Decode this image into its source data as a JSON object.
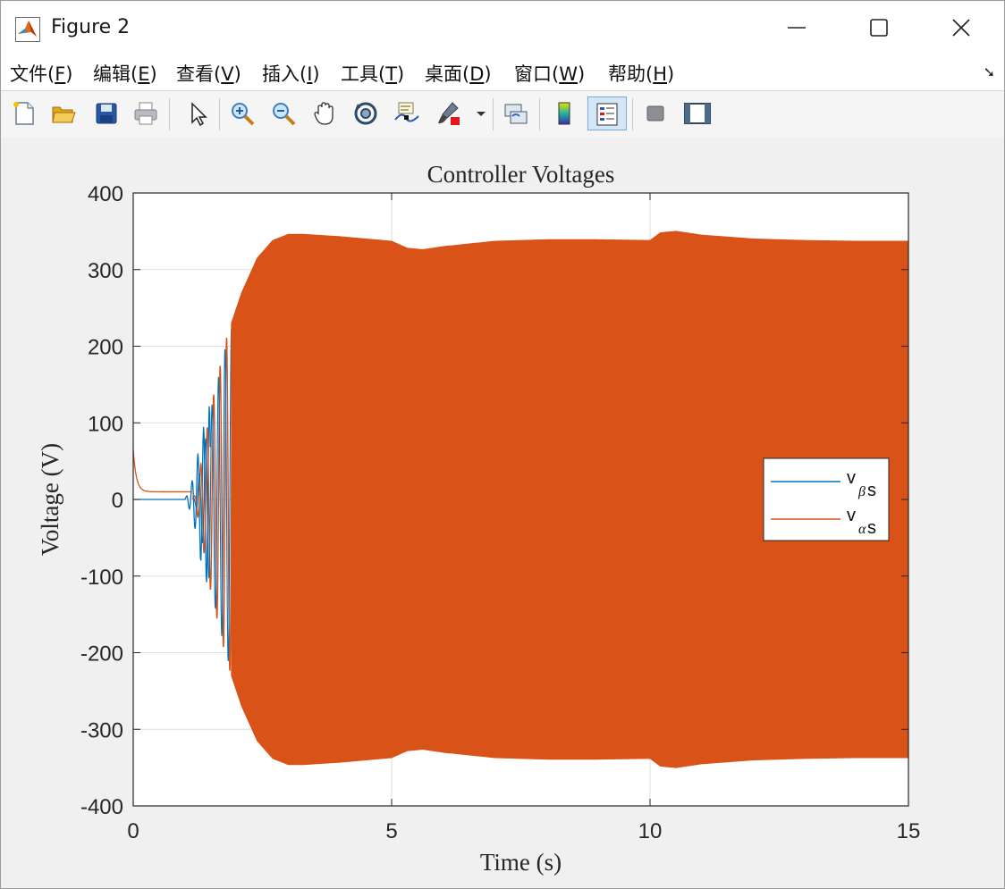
{
  "window": {
    "title": "Figure 2"
  },
  "menu": [
    {
      "label": "文件(",
      "key": "F",
      "tail": ")"
    },
    {
      "label": "编辑(",
      "key": "E",
      "tail": ")"
    },
    {
      "label": "查看(",
      "key": "V",
      "tail": ")"
    },
    {
      "label": "插入(",
      "key": "I",
      "tail": ")"
    },
    {
      "label": "工具(",
      "key": "T",
      "tail": ")"
    },
    {
      "label": "桌面(",
      "key": "D",
      "tail": ")"
    },
    {
      "label": "窗口(",
      "key": "W",
      "tail": ")"
    },
    {
      "label": "帮助(",
      "key": "H",
      "tail": ")"
    }
  ],
  "toolbar": {
    "buttons": [
      "new-figure-icon",
      "open-file-icon",
      "save-icon",
      "print-icon",
      "edit-plot-pointer-icon",
      "zoom-in-icon",
      "zoom-out-icon",
      "pan-hand-icon",
      "rotate-3d-icon",
      "data-cursor-icon",
      "brush-icon",
      "link-plot-icon",
      "colorbar-icon",
      "legend-icon",
      "hide-plot-tools-icon",
      "show-plot-tools-icon"
    ],
    "active": "legend-icon"
  },
  "chart_data": {
    "type": "line",
    "title": "Controller Voltages",
    "xlabel": "Time (s)",
    "ylabel": "Voltage (V)",
    "xlim": [
      0,
      15
    ],
    "ylim": [
      -400,
      400
    ],
    "xticks": [
      "0",
      "5",
      "10",
      "15"
    ],
    "yticks": [
      "400",
      "300",
      "200",
      "100",
      "0",
      "-100",
      "-200",
      "-300",
      "-400"
    ],
    "grid": true,
    "legend_position": "right",
    "series": [
      {
        "name": "v_beta s",
        "legend_main": "v",
        "legend_sub": "β",
        "legend_tail": " s",
        "color": "#0072BD",
        "description": "flat at 0 V until ~1.1 s, then a growing oscillation hidden behind the alpha band",
        "envelope_t": [
          0,
          1.0,
          1.1,
          1.2,
          1.3,
          1.5
        ],
        "envelope_amp": [
          0,
          0,
          15,
          40,
          80,
          130
        ]
      },
      {
        "name": "v_alpha s",
        "legend_main": "v",
        "legend_sub": "α",
        "legend_tail": " s",
        "color": "#D95319",
        "start_value": 65,
        "settle_value": 10,
        "envelope_t": [
          0,
          1.2,
          1.5,
          1.8,
          2.1,
          2.4,
          2.7,
          3.0,
          3.3,
          4.0,
          4.5,
          5.0,
          5.3,
          5.6,
          6.0,
          7.0,
          8.0,
          9.0,
          10.0,
          10.2,
          10.5,
          11.0,
          12.0,
          13.0,
          14.0,
          15.0
        ],
        "envelope_amp": [
          0,
          5,
          120,
          210,
          270,
          315,
          338,
          346,
          346,
          343,
          340,
          337,
          328,
          326,
          330,
          337,
          339,
          339,
          338,
          348,
          350,
          345,
          340,
          338,
          337,
          337
        ]
      }
    ]
  }
}
